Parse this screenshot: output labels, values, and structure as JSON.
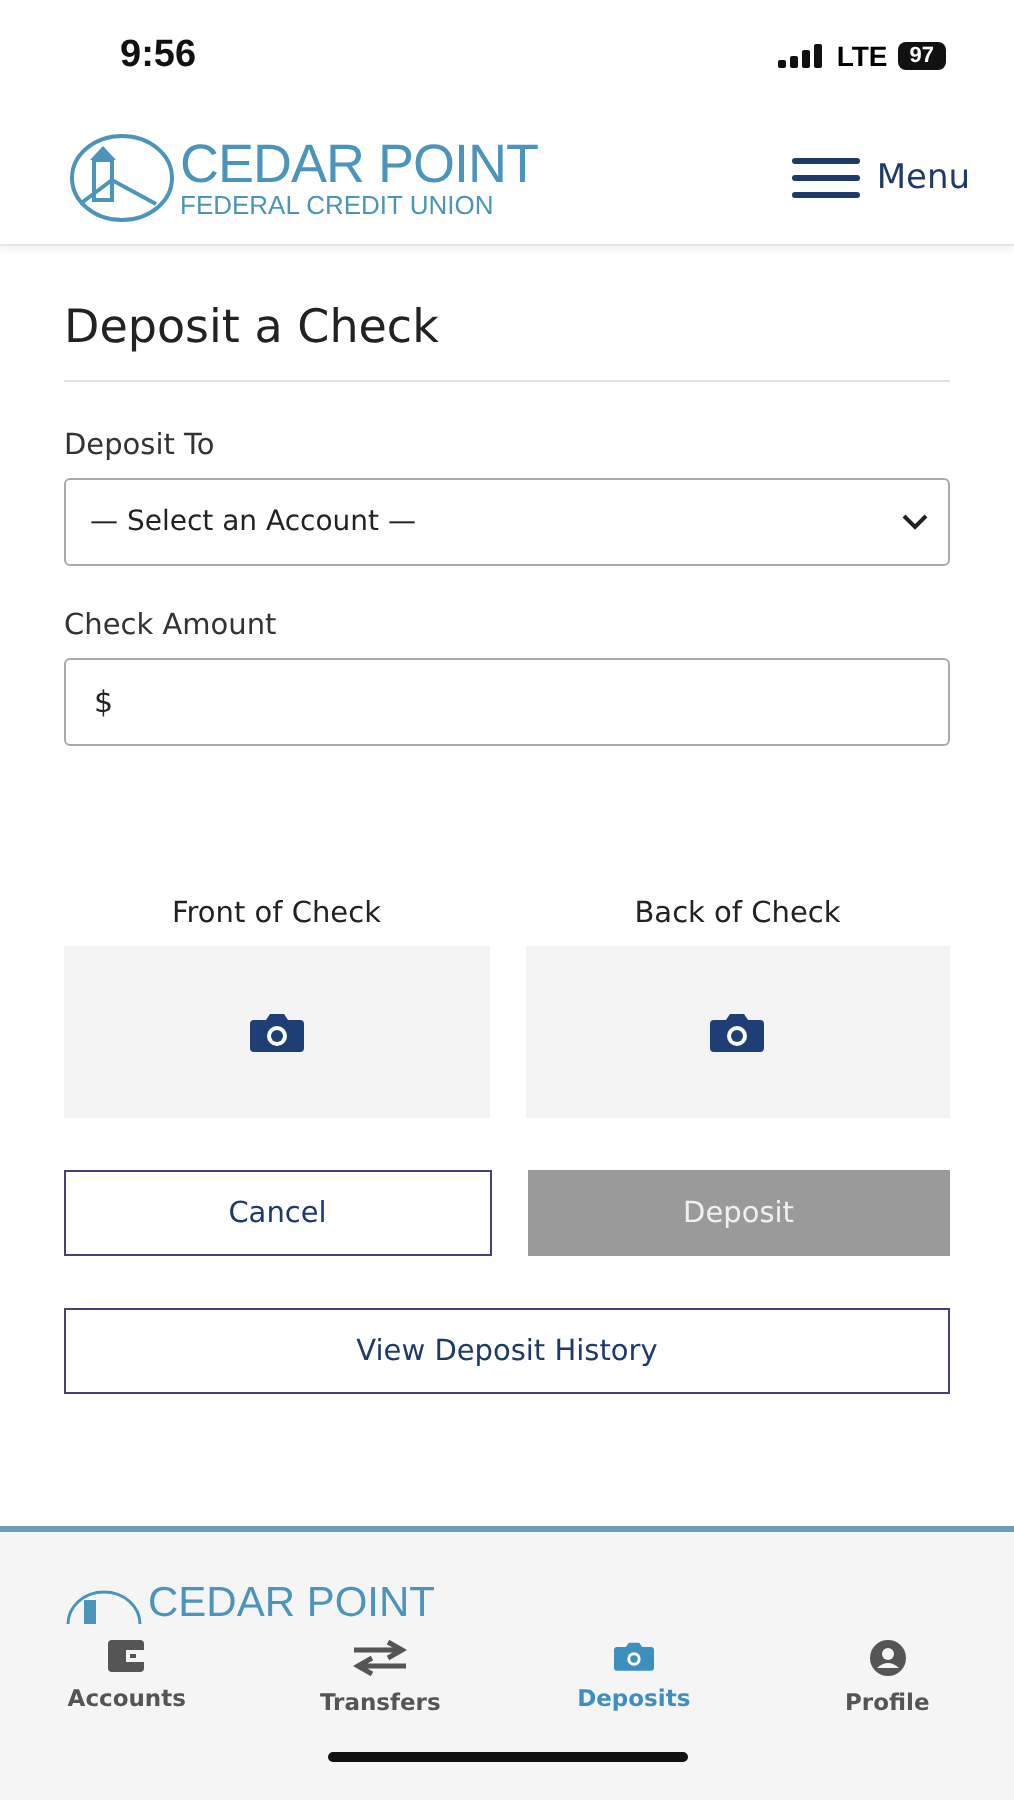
{
  "status_bar": {
    "time": "9:56",
    "network": "LTE",
    "battery": "97"
  },
  "header": {
    "logo_title": "CEDAR POINT",
    "logo_subtitle": "FEDERAL CREDIT UNION",
    "menu_label": "Menu"
  },
  "page_title": "Deposit a Check",
  "deposit_to": {
    "label": "Deposit To",
    "value": "— Select an Account —"
  },
  "check_amount": {
    "label": "Check Amount",
    "prefix": "$"
  },
  "check_images": [
    {
      "label": "Front of Check"
    },
    {
      "label": "Back of Check"
    }
  ],
  "buttons": [
    {
      "label": "Cancel",
      "kind": "outline",
      "disabled": false
    },
    {
      "label": "Deposit",
      "kind": "primary",
      "disabled": true
    }
  ],
  "history_button": "View Deposit History",
  "footer_logo": "CEDAR POINT",
  "tabs": [
    {
      "label": "Accounts",
      "selected": false
    },
    {
      "label": "Transfers",
      "selected": false
    },
    {
      "label": "Deposits",
      "selected": true
    },
    {
      "label": "Profile",
      "selected": false
    }
  ]
}
